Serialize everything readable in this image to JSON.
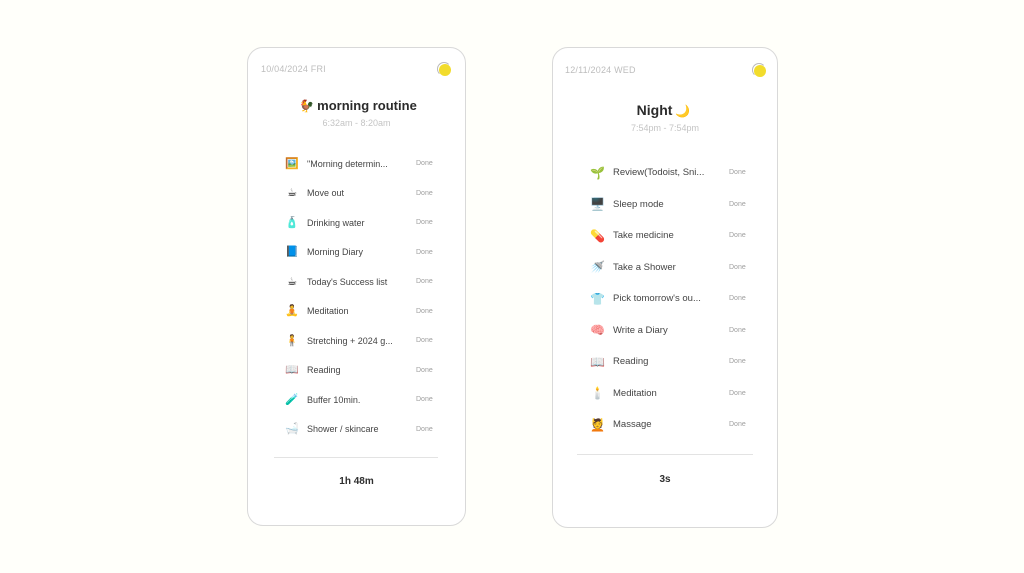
{
  "cards": [
    {
      "date": "10/04/2024 FRI",
      "title_emoji": "🐓",
      "title": "morning routine",
      "time_range": "6:32am - 8:20am",
      "tasks": [
        {
          "icon": "🖼️",
          "icon_name": "framed-picture-icon",
          "label": "\"Morning determin...",
          "status": "Done"
        },
        {
          "icon": "☕",
          "icon_name": "hot-beverage-icon",
          "label": "Move out",
          "status": "Done"
        },
        {
          "icon": "🧴",
          "icon_name": "water-bottle-icon",
          "label": "Drinking water",
          "status": "Done"
        },
        {
          "icon": "📘",
          "icon_name": "notebook-icon",
          "label": "Morning Diary",
          "status": "Done"
        },
        {
          "icon": "☕",
          "icon_name": "hot-beverage-icon",
          "label": "Today's Success list",
          "status": "Done"
        },
        {
          "icon": "🧘",
          "icon_name": "meditation-icon",
          "label": "Meditation",
          "status": "Done"
        },
        {
          "icon": "🧍",
          "icon_name": "stretching-icon",
          "label": "Stretching + 2024 g...",
          "status": "Done"
        },
        {
          "icon": "📖",
          "icon_name": "open-book-icon",
          "label": "Reading",
          "status": "Done"
        },
        {
          "icon": "🧪",
          "icon_name": "buffer-icon",
          "label": "Buffer 10min.",
          "status": "Done"
        },
        {
          "icon": "🛁",
          "icon_name": "bathtub-icon",
          "label": "Shower / skincare",
          "status": "Done"
        }
      ],
      "total": "1h 48m"
    },
    {
      "date": "12/11/2024 WED",
      "title": "Night",
      "title_emoji": "🌙",
      "time_range": "7:54pm - 7:54pm",
      "tasks": [
        {
          "icon": "🌱",
          "icon_name": "seedling-icon",
          "label": "Review(Todoist, Sni...",
          "status": "Done"
        },
        {
          "icon": "🖥️",
          "icon_name": "monitor-icon",
          "label": "Sleep mode",
          "status": "Done"
        },
        {
          "icon": "💊",
          "icon_name": "mortar-pestle-icon",
          "label": "Take medicine",
          "status": "Done"
        },
        {
          "icon": "🚿",
          "icon_name": "shower-icon",
          "label": "Take a Shower",
          "status": "Done"
        },
        {
          "icon": "👕",
          "icon_name": "outfit-icon",
          "label": "Pick tomorrow's ou...",
          "status": "Done"
        },
        {
          "icon": "🧠",
          "icon_name": "brain-icon",
          "label": "Write a Diary",
          "status": "Done"
        },
        {
          "icon": "📖",
          "icon_name": "open-book-icon",
          "label": "Reading",
          "status": "Done"
        },
        {
          "icon": "🕯️",
          "icon_name": "candle-icon",
          "label": "Meditation",
          "status": "Done"
        },
        {
          "icon": "💆",
          "icon_name": "massage-icon",
          "label": "Massage",
          "status": "Done"
        }
      ],
      "total": "3s"
    }
  ]
}
